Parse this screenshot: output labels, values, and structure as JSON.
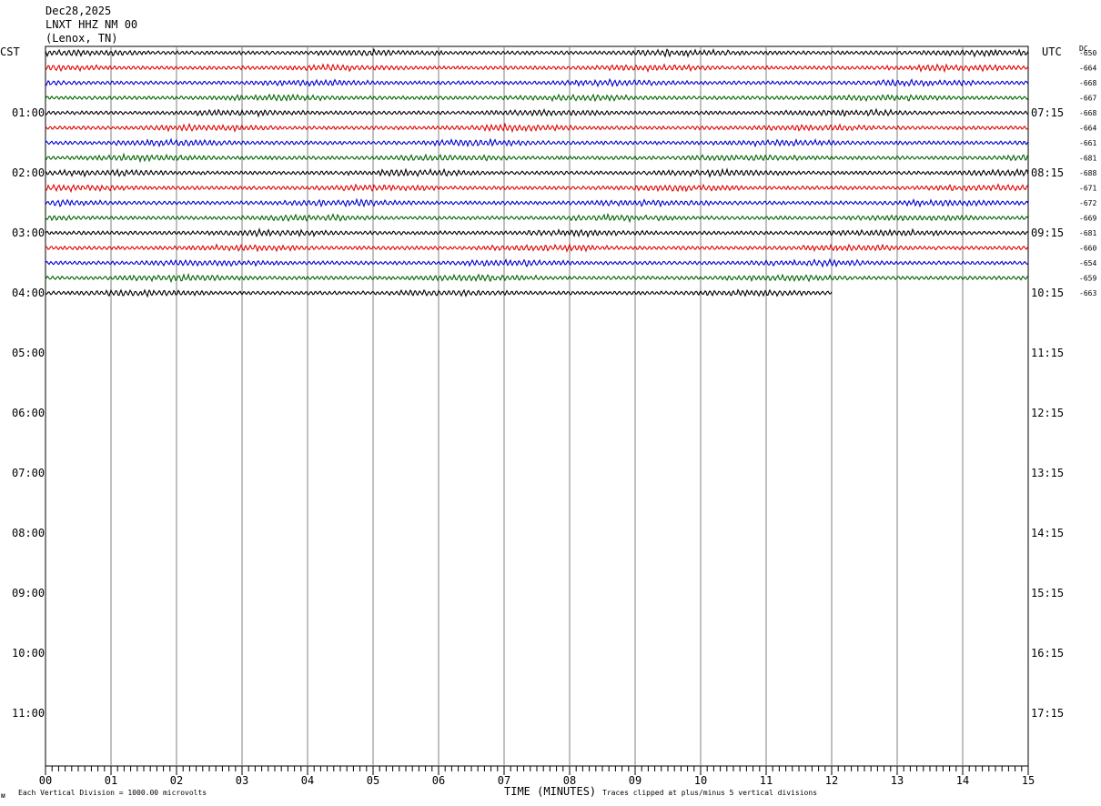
{
  "header": {
    "date": "Dec28,2025",
    "station": "LNXT HHZ NM 00",
    "location": "(Lenox, TN)"
  },
  "left_axis_title": "CST",
  "right_axis_title": "UTC",
  "dc_title": "DC",
  "footer": {
    "scale_note": "Each Vertical Division = 1000.00 microvolts",
    "xlabel": "TIME (MINUTES)",
    "clip_note": "Traces clipped at plus/minus 5 vertical divisions",
    "corner_mark": "ᴍ"
  },
  "chart_data": {
    "type": "line",
    "title": "LNXT HHZ NM 00",
    "xlabel": "TIME (MINUTES)",
    "xlim": [
      0,
      15
    ],
    "x_ticks": [
      "00",
      "01",
      "02",
      "03",
      "04",
      "05",
      "06",
      "07",
      "08",
      "09",
      "10",
      "11",
      "12",
      "13",
      "14",
      "15"
    ],
    "left_hour_labels": [
      "01:00",
      "02:00",
      "03:00",
      "04:00",
      "05:00",
      "06:00",
      "07:00",
      "08:00",
      "09:00",
      "10:00",
      "11:00"
    ],
    "right_hour_labels": [
      "07:15",
      "08:15",
      "09:15",
      "10:15",
      "11:15",
      "12:15",
      "13:15",
      "14:15",
      "15:15",
      "16:15",
      "17:15"
    ],
    "trace_colors": [
      "#000000",
      "#e00000",
      "#0000d0",
      "#006400"
    ],
    "trace_dc_offsets": [
      -650,
      -664,
      -668,
      -667,
      -668,
      -664,
      -661,
      -681,
      -688,
      -671,
      -672,
      -669,
      -681,
      -660,
      -654,
      -659,
      -663
    ],
    "trace_end_minutes": [
      15,
      15,
      15,
      15,
      15,
      15,
      15,
      15,
      15,
      15,
      15,
      15,
      15,
      15,
      15,
      15,
      12
    ],
    "minutes_per_trace": 15,
    "grid": true
  }
}
